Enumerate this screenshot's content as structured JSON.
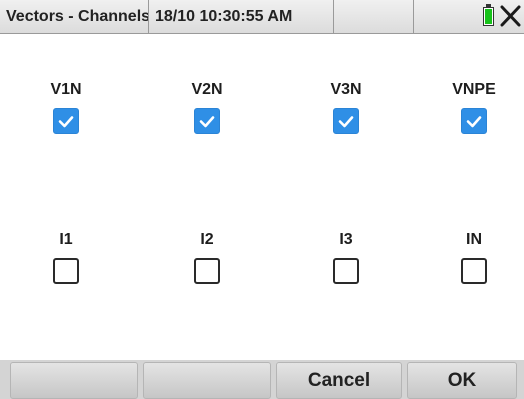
{
  "header": {
    "title": "Vectors - Channels",
    "datetime": "18/10 10:30:55 AM",
    "battery_icon": "battery-icon",
    "battery_color": "#17c21a",
    "close_icon": "close-icon"
  },
  "voltage_channels": [
    {
      "label": "V1N",
      "checked": true
    },
    {
      "label": "V2N",
      "checked": true
    },
    {
      "label": "V3N",
      "checked": true
    },
    {
      "label": "VNPE",
      "checked": true
    }
  ],
  "current_channels": [
    {
      "label": "I1",
      "checked": false
    },
    {
      "label": "I2",
      "checked": false
    },
    {
      "label": "I3",
      "checked": false
    },
    {
      "label": "IN",
      "checked": false
    }
  ],
  "softkeys": [
    "",
    "",
    "Cancel",
    "OK"
  ],
  "colors": {
    "checked_fill": "#2f8fe6",
    "checkmark": "#ffffff",
    "unchecked_border": "#2a2a2a"
  }
}
